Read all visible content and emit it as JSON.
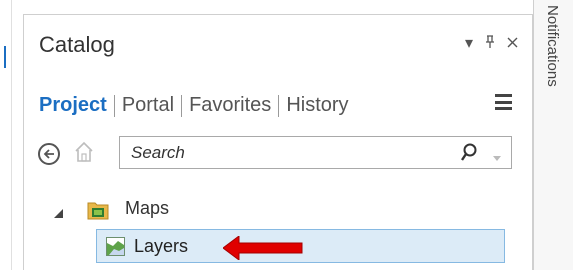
{
  "pane": {
    "title": "Catalog",
    "controls": {
      "dropdown_glyph": "▾",
      "pin_glyph": "̧",
      "close_glyph": "×"
    }
  },
  "tabs": [
    {
      "label": "Project",
      "active": true
    },
    {
      "label": "Portal",
      "active": false
    },
    {
      "label": "Favorites",
      "active": false
    },
    {
      "label": "History",
      "active": false
    }
  ],
  "search": {
    "placeholder": "Search"
  },
  "tree": {
    "folder": {
      "label": "Maps",
      "icon": "folder-icon"
    },
    "item": {
      "label": "Layers",
      "icon": "map-icon",
      "selected": true
    }
  },
  "side_tab": {
    "label": "Notifications"
  },
  "colors": {
    "accent": "#1b6ec2",
    "selection": "#dcebf7",
    "arrow": "#e00000"
  }
}
